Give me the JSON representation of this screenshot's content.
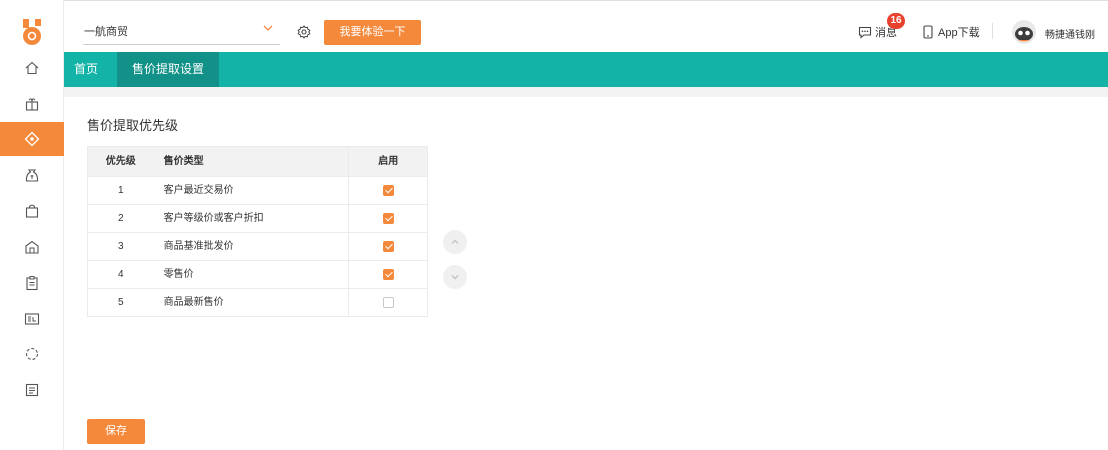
{
  "header": {
    "company": "一航商贸",
    "try_button": "我要体验一下",
    "messages_label": "消息",
    "messages_badge": "16",
    "app_download": "App下载",
    "username": "畅捷通钱刚"
  },
  "tabs": [
    {
      "label": "首页"
    },
    {
      "label": "售价提取设置"
    }
  ],
  "sidebar": {
    "items": [
      {
        "icon": "home-icon"
      },
      {
        "icon": "gift-icon"
      },
      {
        "icon": "tag-icon",
        "active": true
      },
      {
        "icon": "money-bag-icon"
      },
      {
        "icon": "shopping-bag-icon"
      },
      {
        "icon": "warehouse-icon"
      },
      {
        "icon": "clipboard-icon"
      },
      {
        "icon": "report-icon"
      },
      {
        "icon": "loading-circle-icon"
      },
      {
        "icon": "document-icon"
      }
    ]
  },
  "main": {
    "title": "售价提取优先级",
    "table": {
      "headers": [
        "优先级",
        "售价类型",
        "启用"
      ],
      "rows": [
        {
          "priority": "1",
          "type": "客户最近交易价",
          "enabled": true
        },
        {
          "priority": "2",
          "type": "客户等级价或客户折扣",
          "enabled": true
        },
        {
          "priority": "3",
          "type": "商品基准批发价",
          "enabled": true
        },
        {
          "priority": "4",
          "type": "零售价",
          "enabled": true
        },
        {
          "priority": "5",
          "type": "商品最新售价",
          "enabled": false
        }
      ]
    },
    "save_button": "保存"
  },
  "colors": {
    "accent": "#f5893b",
    "teal": "#14b3a7",
    "teal_dark": "#119187",
    "badge": "#e8412d"
  }
}
